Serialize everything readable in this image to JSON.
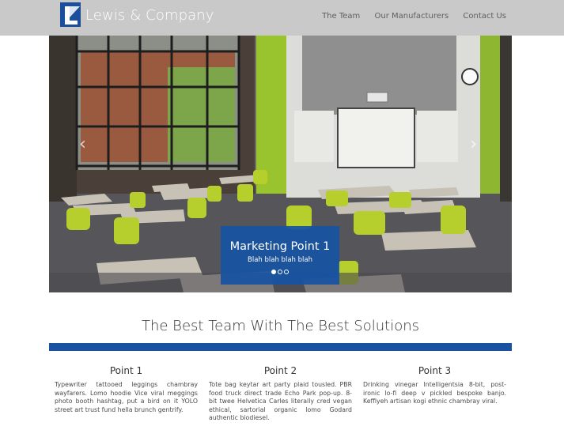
{
  "brand": {
    "name": "Lewis & Company"
  },
  "nav": {
    "items": [
      "The Team",
      "Our Manufacturers",
      "Contact Us"
    ]
  },
  "carousel": {
    "caption_title": "Marketing Point 1",
    "caption_text": "Blah blah blah blah",
    "slide_count": 3,
    "active_slide": 1,
    "prev_icon": "chevron-left-icon",
    "next_icon": "chevron-right-icon"
  },
  "section": {
    "headline": "The Best Team With The Best Solutions"
  },
  "points": [
    {
      "title": "Point 1",
      "text": "Typewriter tattooed leggings chambray wayfarers. Lomo hoodie Vice viral meggings photo booth hashtag, put a bird on it YOLO street art trust fund hella brunch gentrify."
    },
    {
      "title": "Point 2",
      "text": "Tote bag keytar art party plaid tousled. PBR food truck direct trade Echo Park pop-up. 8-bit twee Helvetica Carles literally cred vegan ethical, sartorial organic lomo Godard authentic biodiesel."
    },
    {
      "title": "Point 3",
      "text": "Drinking vinegar Intelligentsia 8-bit, post-ironic lo-fi deep v pickled bespoke banjo. Keffiyeh artisan kogi ethnic chambray viral."
    }
  ],
  "colors": {
    "navbar": "#c9c9c9",
    "accent_blue": "#1a52a2",
    "caption_bg": "#1853a3"
  }
}
